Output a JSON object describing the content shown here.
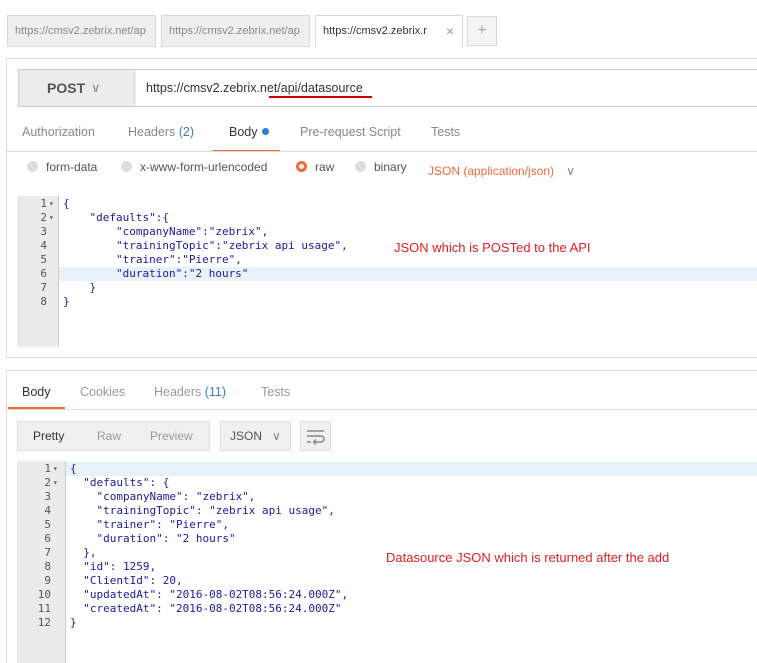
{
  "tabs": [
    {
      "label": "https://cmsv2.zebrix.net/ap"
    },
    {
      "label": "https://cmsv2.zebrix.net/ap"
    },
    {
      "label": "https://cmsv2.zebrix.r"
    }
  ],
  "tab_close": "×",
  "tab_add": "+",
  "request": {
    "method": "POST",
    "chevron": "∨",
    "url": "https://cmsv2.zebrix.net/api/datasource",
    "tabs": {
      "authorization": "Authorization",
      "headers": "Headers",
      "headers_count": "(2)",
      "body": "Body",
      "prerequest": "Pre-request Script",
      "tests": "Tests"
    },
    "body_types": {
      "form_data": "form-data",
      "urlencoded": "x-www-form-urlencoded",
      "raw": "raw",
      "binary": "binary",
      "content_type": "JSON (application/json)"
    },
    "code_lines": [
      "{",
      "    \"defaults\":{",
      "        \"companyName\":\"zebrix\",",
      "        \"trainingTopic\":\"zebrix api usage\",",
      "        \"trainer\":\"Pierre\",",
      "        \"duration\":\"2 hours\"",
      "    }",
      "}"
    ]
  },
  "annotations": {
    "request": "JSON which is POSTed to the API",
    "response": "Datasource JSON which is returned after the add"
  },
  "response": {
    "tabs": {
      "body": "Body",
      "cookies": "Cookies",
      "headers": "Headers",
      "headers_count": "(11)",
      "tests": "Tests"
    },
    "formats": {
      "pretty": "Pretty",
      "raw": "Raw",
      "preview": "Preview"
    },
    "format_type": "JSON",
    "code_lines": [
      "{",
      "  \"defaults\": {",
      "    \"companyName\": \"zebrix\",",
      "    \"trainingTopic\": \"zebrix api usage\",",
      "    \"trainer\": \"Pierre\",",
      "    \"duration\": \"2 hours\"",
      "  },",
      "  \"id\": 1259,",
      "  \"ClientId\": 20,",
      "  \"updatedAt\": \"2016-08-02T08:56:24.000Z\",",
      "  \"createdAt\": \"2016-08-02T08:56:24.000Z\"",
      "}"
    ]
  },
  "colors": {
    "accent": "#f26b3a",
    "annotation": "#e02020",
    "link_count": "#3b7ac8"
  }
}
